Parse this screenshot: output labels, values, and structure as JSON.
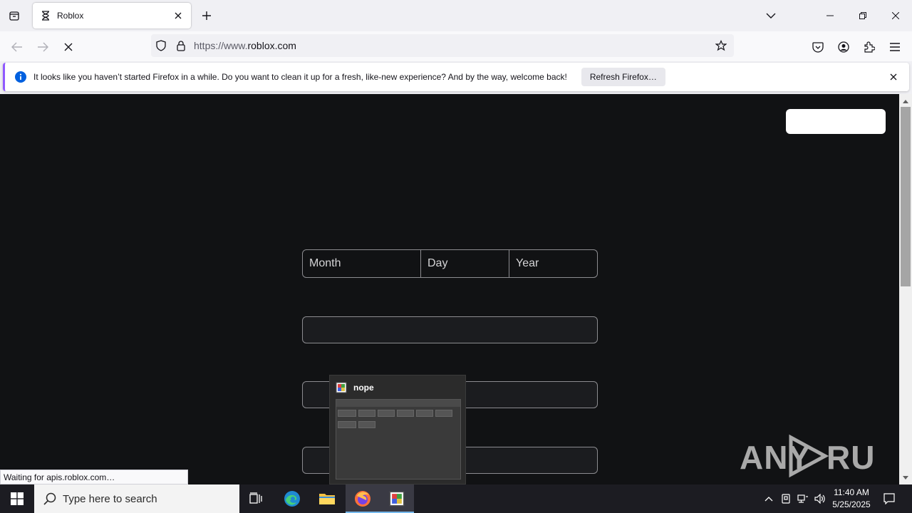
{
  "browser": {
    "tab_title": "Roblox",
    "url_prefix": "https://www.",
    "url_domain": "roblox.com"
  },
  "notification": {
    "message": "It looks like you haven’t started Firefox in a while. Do you want to clean it up for a fresh, like-new experience? And by the way, welcome back!",
    "button_label": "Refresh Firefox…"
  },
  "form": {
    "dob_month": "Month",
    "dob_day": "Day",
    "dob_year": "Year"
  },
  "status_text": "Waiting for apis.roblox.com…",
  "taskbar": {
    "search_placeholder": "Type here to search",
    "preview_title": "nope",
    "time": "11:40 AM",
    "date": "5/25/2025"
  },
  "watermark": "ANY RUN",
  "colors": {
    "page_bg": "#111214",
    "accent": "#9059ff",
    "info_blue": "#0060df"
  }
}
